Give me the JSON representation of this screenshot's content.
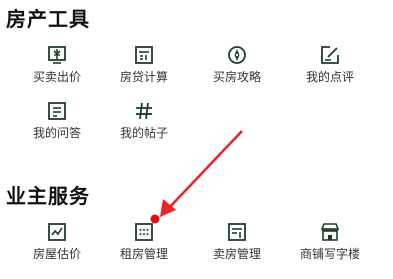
{
  "sections": [
    {
      "title": "房产工具",
      "items": [
        {
          "label": "买卖出价",
          "icon": "price-tag-icon"
        },
        {
          "label": "房贷计算",
          "icon": "calculator-icon"
        },
        {
          "label": "买房攻略",
          "icon": "compass-icon"
        },
        {
          "label": "我的点评",
          "icon": "edit-review-icon"
        },
        {
          "label": "我的问答",
          "icon": "qa-icon"
        },
        {
          "label": "我的帖子",
          "icon": "hashtag-icon"
        }
      ]
    },
    {
      "title": "业主服务",
      "items": [
        {
          "label": "房屋估价",
          "icon": "chart-icon"
        },
        {
          "label": "租房管理",
          "icon": "rent-grid-icon"
        },
        {
          "label": "卖房管理",
          "icon": "sell-house-icon"
        },
        {
          "label": "商铺写字楼",
          "icon": "shop-icon"
        }
      ]
    }
  ],
  "annotation": {
    "color": "#ee2222",
    "target": "租房管理"
  }
}
